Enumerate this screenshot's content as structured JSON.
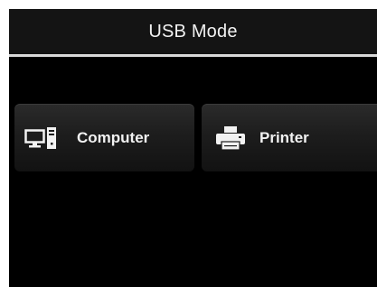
{
  "header": {
    "title": "USB Mode"
  },
  "options": [
    {
      "label": "Computer",
      "icon": "computer-icon"
    },
    {
      "label": "Printer",
      "icon": "printer-icon"
    }
  ],
  "colors": {
    "background": "#000000",
    "title_bar": "#141414",
    "divider": "#d9d9d9",
    "text": "#f2f2f2"
  }
}
